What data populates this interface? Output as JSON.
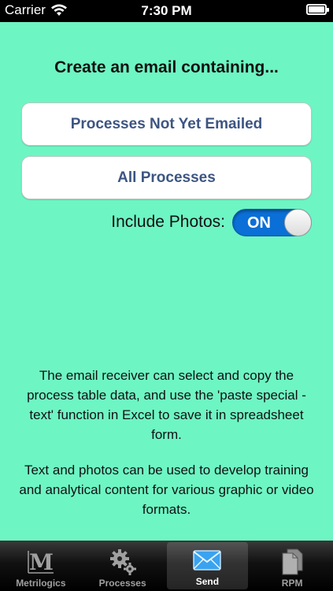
{
  "status_bar": {
    "carrier": "Carrier",
    "time": "7:30 PM"
  },
  "main": {
    "heading": "Create an email containing...",
    "button_not_emailed": "Processes Not Yet Emailed",
    "button_all": "All Processes",
    "photos_label": "Include Photos:",
    "photos_toggle": "ON",
    "info_1": "The email receiver can select and copy the process table data, and use the 'paste special - text' function in Excel to save it in spreadsheet form.",
    "info_2": "Text and photos can be used to develop training and analytical content for various graphic or video formats."
  },
  "tab_bar": {
    "tabs": [
      {
        "label": "Metrilogics",
        "icon": "metrilogics-logo-icon"
      },
      {
        "label": "Processes",
        "icon": "gears-icon"
      },
      {
        "label": "Send",
        "icon": "envelope-icon"
      },
      {
        "label": "RPM",
        "icon": "documents-icon"
      }
    ],
    "selected": "Send"
  },
  "colors": {
    "background": "#6ef5c4",
    "button_text": "#3d5582",
    "toggle_on": "#0a6fd6"
  }
}
